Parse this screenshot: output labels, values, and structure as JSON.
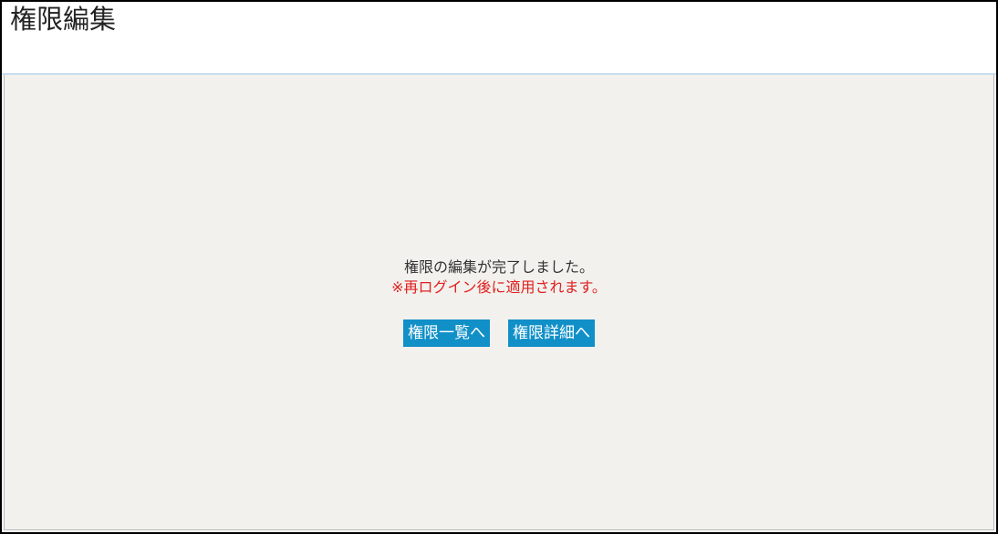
{
  "header": {
    "title": "権限編集"
  },
  "message": {
    "main": "権限の編集が完了しました。",
    "note": "※再ログイン後に適用されます。"
  },
  "buttons": {
    "list_label": "権限一覧へ",
    "detail_label": "権限詳細へ"
  },
  "colors": {
    "button_bg": "#1190c8",
    "note_text": "#e02020",
    "content_bg": "#f2f1ed",
    "header_border": "#c9ddf0"
  }
}
